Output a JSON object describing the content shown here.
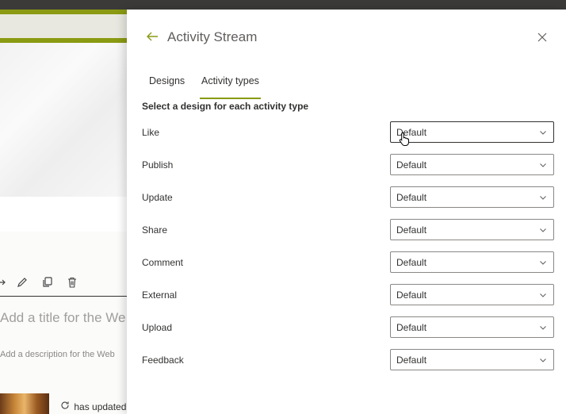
{
  "background_page": {
    "title_placeholder": "Add a title for the We",
    "description_placeholder": "Add a description for the Web",
    "update_text": "has updated"
  },
  "panel": {
    "title": "Activity Stream",
    "tabs": [
      {
        "label": "Designs",
        "active": false
      },
      {
        "label": "Activity types",
        "active": true
      }
    ],
    "subheading": "Select a design for each activity type",
    "activity_types": [
      {
        "label": "Like",
        "value": "Default"
      },
      {
        "label": "Publish",
        "value": "Default"
      },
      {
        "label": "Update",
        "value": "Default"
      },
      {
        "label": "Share",
        "value": "Default"
      },
      {
        "label": "Comment",
        "value": "Default"
      },
      {
        "label": "External",
        "value": "Default"
      },
      {
        "label": "Upload",
        "value": "Default"
      },
      {
        "label": "Feedback",
        "value": "Default"
      }
    ]
  },
  "colors": {
    "accent": "#8a9a12",
    "text": "#323130",
    "border": "#8a8886"
  }
}
